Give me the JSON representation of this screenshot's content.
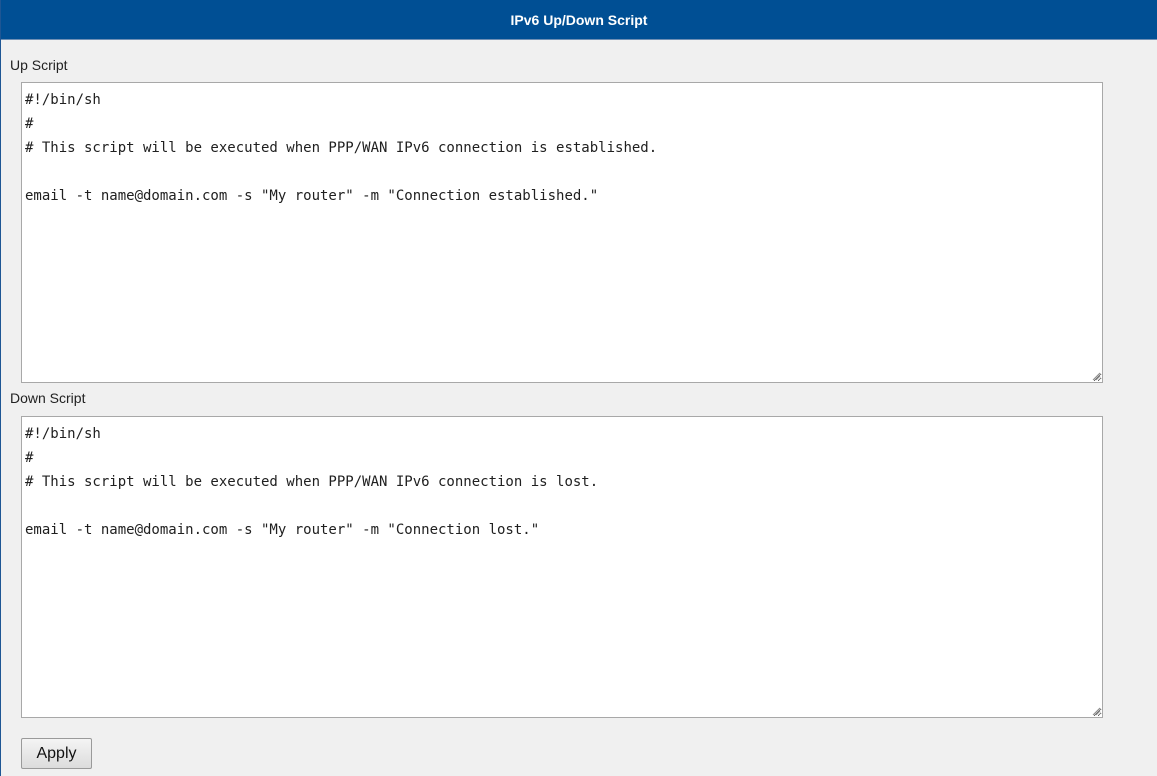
{
  "header": {
    "title": "IPv6 Up/Down Script"
  },
  "up_script": {
    "label": "Up Script",
    "content": "#!/bin/sh\n#\n# This script will be executed when PPP/WAN IPv6 connection is established.\n\nemail -t name@domain.com -s \"My router\" -m \"Connection established.\""
  },
  "down_script": {
    "label": "Down Script",
    "content": "#!/bin/sh\n#\n# This script will be executed when PPP/WAN IPv6 connection is lost.\n\nemail -t name@domain.com -s \"My router\" -m \"Connection lost.\""
  },
  "actions": {
    "apply_label": "Apply"
  },
  "colors": {
    "title_bar": "#004f94",
    "panel_background": "#f0f0f0"
  }
}
